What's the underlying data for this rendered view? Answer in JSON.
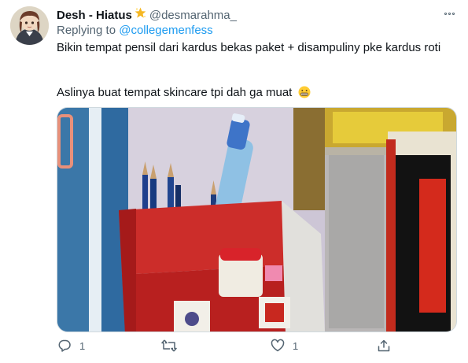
{
  "tweet": {
    "display_name": "Desh - Hiatus",
    "handle": "@desmarahma_",
    "replying_to_prefix": "Replying to",
    "replying_to_handle": "@collegemenfess",
    "text_line1": "Bikin tempat pensil dari kardus bekas paket + disampuliny pke kardus roti",
    "text_line2": "Aslinya buat tempat skincare tpi dah ga muat",
    "emoji_name": "grimacing-face-emoji",
    "star_icon": "star-emoji"
  },
  "actions": {
    "reply_count": "1",
    "retweet_count": "",
    "like_count": "1"
  },
  "colors": {
    "text": "#0f1419",
    "secondary": "#536471",
    "link": "#1d9bf0"
  }
}
